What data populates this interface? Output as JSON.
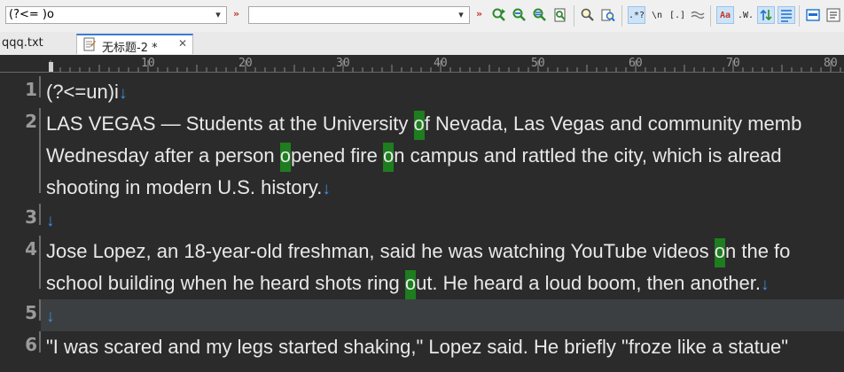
{
  "toolbar": {
    "find_value": "(?<= )o",
    "replace_value": "",
    "chevron": "»",
    "regex_label": ".*?",
    "newline_label": "\\n",
    "charclass_label": "[.]",
    "case_label": "Aa",
    "word_label": ".W."
  },
  "tabs": [
    {
      "label": "qqq.txt",
      "active": false
    },
    {
      "label": "无标题-2 *",
      "active": true
    }
  ],
  "ruler": {
    "marks": [
      "10",
      "20",
      "30",
      "40",
      "50",
      "60",
      "70",
      "80"
    ]
  },
  "gutter": {
    "numbers": [
      "1",
      "2",
      "3",
      "4",
      "5",
      "6"
    ]
  },
  "lines": {
    "l1": "(?<=un)i",
    "l2a_1": "LAS VEGAS — Students at the University ",
    "l2a_h1": "o",
    "l2a_2": "f Nevada, Las Vegas and community memb",
    "l2b_1": "Wednesday after a person ",
    "l2b_h1": "o",
    "l2b_2": "pened fire ",
    "l2b_h2": "o",
    "l2b_3": "n campus and rattled the city, which is alread",
    "l2c": "shooting in modern U.S. history.",
    "l4a_1": "Jose Lopez, an 18-year-old freshman, said he was watching YouTube videos ",
    "l4a_h1": "o",
    "l4a_2": "n the fo",
    "l4b_1": "school building when he heard shots ring ",
    "l4b_h1": "o",
    "l4b_2": "ut. He heard a loud boom, then another.",
    "l6": "\"I was scared and my legs started shaking,\" Lopez said. He briefly \"froze like a statue\""
  },
  "symbols": {
    "newline_marker": "↓"
  },
  "colors": {
    "editor_bg": "#2b2b2b",
    "current_line_bg": "#3c3f41",
    "match_highlight": "#1e7d1e",
    "line_numbers": "#9a9a9a",
    "newline_marker": "#3b8ee0",
    "active_tab_accent": "#3b7bd4"
  }
}
